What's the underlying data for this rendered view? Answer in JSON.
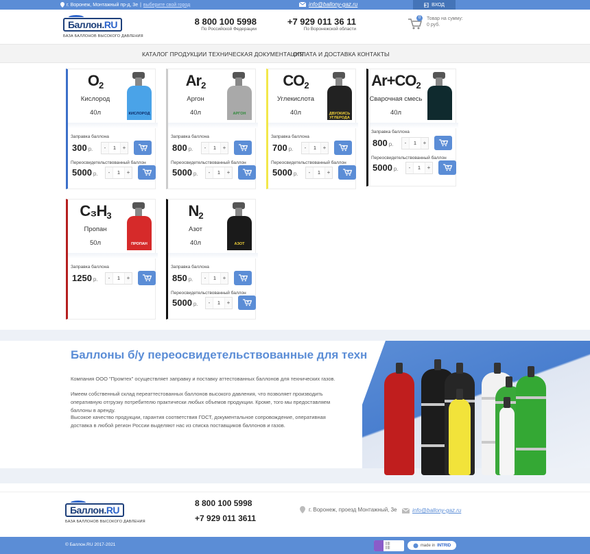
{
  "topbar": {
    "address": "г. Воронеж, Монтажный пр-д, 3е",
    "choose_city": "выберите свой город",
    "email": "info@ballony-gaz.ru",
    "login": "ВХОД"
  },
  "header": {
    "logo_text_a": "Баллон.",
    "logo_text_b": "RU",
    "logo_sub": "БАЗА БАЛЛОНОВ ВЫСОКОГО ДАВЛЕНИЯ",
    "phone1": "8 800 100 5998",
    "phone1_caption": "По Российской Федерации",
    "phone2": "+7 929 011 36 11",
    "phone2_caption": "По Воронежской области",
    "cart_count": "0",
    "cart_line1": "Товар на сумму:",
    "cart_line2": "0 руб."
  },
  "nav": [
    "КАТАЛОГ ПРОДУКЦИИ",
    "ТЕХНИЧЕСКАЯ ДОКУМЕНТАЦИЯ",
    "ОПЛАТА И ДОСТАВКА",
    "КОНТАКТЫ"
  ],
  "labels": {
    "refill": "Заправка баллона",
    "recert": "Переосвидетельствованный баллон",
    "rub": "р.",
    "minus": "-",
    "plus": "+",
    "qty": "1"
  },
  "products": [
    {
      "f_main": "O",
      "f_sub": "2",
      "name": "Кислород",
      "volume": "40л",
      "accent": "#3b6fc9",
      "cyl_color": "#4aa3e8",
      "cyl_label": "КИСЛОРОД",
      "cyl_label_color": "#0b2a66",
      "refill_price": "300",
      "recert_price": "5000"
    },
    {
      "f_main": "Ar",
      "f_sub": "2",
      "name": "Аргон",
      "volume": "40л",
      "accent": "#cccccc",
      "cyl_color": "#a9a9a9",
      "cyl_label": "АРГОН",
      "cyl_label_color": "#2f8a3a",
      "refill_price": "800",
      "recert_price": "5000"
    },
    {
      "f_main": "CO",
      "f_sub": "2",
      "name": "Углекислота",
      "volume": "40л",
      "accent": "#f2e84a",
      "cyl_color": "#222222",
      "cyl_label": "ДВУОКИСЬ УГЛЕРОДА",
      "cyl_label_color": "#f2d23a",
      "refill_price": "700",
      "recert_price": "5000"
    },
    {
      "f_main": "Ar+CO",
      "f_sub": "2",
      "name": "Сварочная смесь",
      "volume": "40л",
      "accent": "#111111",
      "cyl_color": "#0f2a2e",
      "cyl_label": "",
      "cyl_label_color": "#ffffff",
      "refill_price": "800",
      "recert_price": "5000"
    },
    {
      "f_main": "C₃H",
      "f_sub": "3",
      "name": "Пропан",
      "volume": "50л",
      "accent": "#b51f1f",
      "cyl_color": "#d62a2a",
      "cyl_label": "ПРОПАН",
      "cyl_label_color": "#ffffff",
      "refill_price": "1250",
      "recert_price": ""
    },
    {
      "f_main": "N",
      "f_sub": "2",
      "name": "Азот",
      "volume": "40л",
      "accent": "#111111",
      "cyl_color": "#1a1a1a",
      "cyl_label": "АЗОТ",
      "cyl_label_color": "#f2d23a",
      "refill_price": "850",
      "recert_price": "5000"
    }
  ],
  "promo": {
    "title": "Баллоны б/у переосвидетельствованные для техническ",
    "p1": "Компания ООО \"Промтех\" осуществляет заправку и поставку аттестованных баллонов для технических газов.",
    "p2": "Имеем собственный склад переаттестованных баллонов высокого давления, что позволяет производить оперативную отгрузку потребителю практически любых объемов продукции. Кроме, того мы предоставляем баллоны в аренду.",
    "p3": "Высокое качество продукции, гарантия соответствия ГОСТ, документальное сопровождение, оперативная доставка в любой регион России выделяют нас из списка поставщиков баллонов и газов."
  },
  "footer": {
    "phone1": "8 800 100 5998",
    "phone2": "+7 929 011 3611",
    "address": "г. Воронеж, проезд Монтажный, 3е",
    "email": "info@ballony-gaz.ru",
    "copyright": "© Баллон.RU 2017-2021",
    "made_in": "made in",
    "made_brand": "INTRID"
  },
  "colors": {
    "accent": "#5b8dd6",
    "dark_blue": "#1d3f7a"
  }
}
